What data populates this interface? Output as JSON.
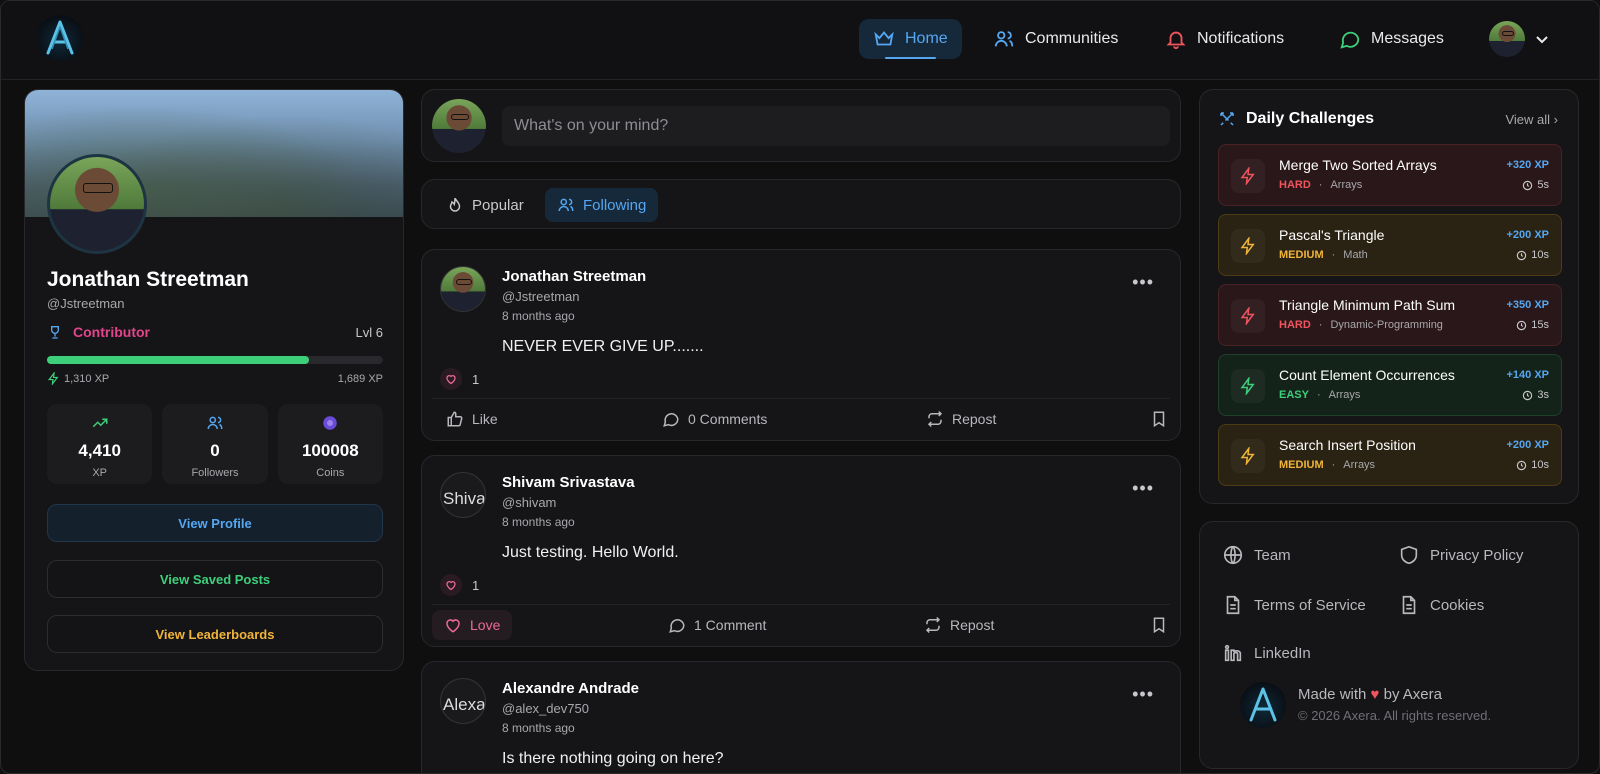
{
  "app": {
    "brand": "Axera"
  },
  "nav": {
    "items": [
      {
        "label": "Home",
        "icon": "crown-icon",
        "active": true
      },
      {
        "label": "Communities",
        "icon": "users-icon"
      },
      {
        "label": "Notifications",
        "icon": "bell-icon"
      },
      {
        "label": "Messages",
        "icon": "message-circle-icon"
      }
    ]
  },
  "profile": {
    "name": "Jonathan Streetman",
    "handle": "@Jstreetman",
    "role": "Contributor",
    "level": "Lvl 6",
    "xp_progress": 0.78,
    "xp_current": "1,310 XP",
    "xp_remaining": "1,689 XP",
    "stats": [
      {
        "value": "4,410",
        "label": "XP",
        "icon": "trending-up-icon"
      },
      {
        "value": "0",
        "label": "Followers",
        "icon": "users-icon"
      },
      {
        "value": "100008",
        "label": "Coins",
        "icon": "coin-icon"
      }
    ],
    "buttons": {
      "view_profile": "View Profile",
      "saved_posts": "View Saved Posts",
      "leaderboards": "View Leaderboards"
    }
  },
  "composer": {
    "placeholder": "What's on your mind?"
  },
  "feed_tabs": [
    {
      "label": "Popular",
      "icon": "flame-icon"
    },
    {
      "label": "Following",
      "icon": "users-icon",
      "active": true
    }
  ],
  "posts": [
    {
      "author": "Jonathan Streetman",
      "handle": "@Jstreetman",
      "time": "8 months ago",
      "body": "NEVER EVER GIVE UP.......",
      "likes": "1",
      "like_label": "Like",
      "comments_label": "0 Comments",
      "repost_label": "Repost",
      "avatar_alt": ""
    },
    {
      "author": "Shivam Srivastava",
      "handle": "@shivam",
      "time": "8 months ago",
      "body": "Just testing. Hello World.",
      "likes": "1",
      "like_label": "Love",
      "comments_label": "1 Comment",
      "repost_label": "Repost",
      "avatar_alt": "Shiva"
    },
    {
      "author": "Alexandre Andrade",
      "handle": "@alex_dev750",
      "time": "8 months ago",
      "body": "Is there nothing going on here?",
      "avatar_alt": "Alexa"
    }
  ],
  "challenges": {
    "title": "Daily Challenges",
    "view_all": "View all",
    "items": [
      {
        "name": "Merge Two Sorted Arrays",
        "difficulty": "HARD",
        "topic": "Arrays",
        "xp": "+320 XP",
        "time": "5s"
      },
      {
        "name": "Pascal's Triangle",
        "difficulty": "MEDIUM",
        "topic": "Math",
        "xp": "+200 XP",
        "time": "10s"
      },
      {
        "name": "Triangle Minimum Path Sum",
        "difficulty": "HARD",
        "topic": "Dynamic-Programming",
        "xp": "+350 XP",
        "time": "15s"
      },
      {
        "name": "Count Element Occurrences",
        "difficulty": "EASY",
        "topic": "Arrays",
        "xp": "+140 XP",
        "time": "3s"
      },
      {
        "name": "Search Insert Position",
        "difficulty": "MEDIUM",
        "topic": "Arrays",
        "xp": "+200 XP",
        "time": "10s"
      }
    ]
  },
  "footer": {
    "links": [
      "Team",
      "Privacy Policy",
      "Terms of Service",
      "Cookies",
      "LinkedIn"
    ],
    "made_with_prefix": "Made with",
    "made_with_suffix": "by Axera",
    "copyright": "© 2026 Axera. All rights reserved."
  },
  "colors": {
    "accent": "#55a7f2",
    "success": "#3ecf7b",
    "danger": "#f0555e",
    "warning": "#f0b43a",
    "role": "#e2458b"
  }
}
